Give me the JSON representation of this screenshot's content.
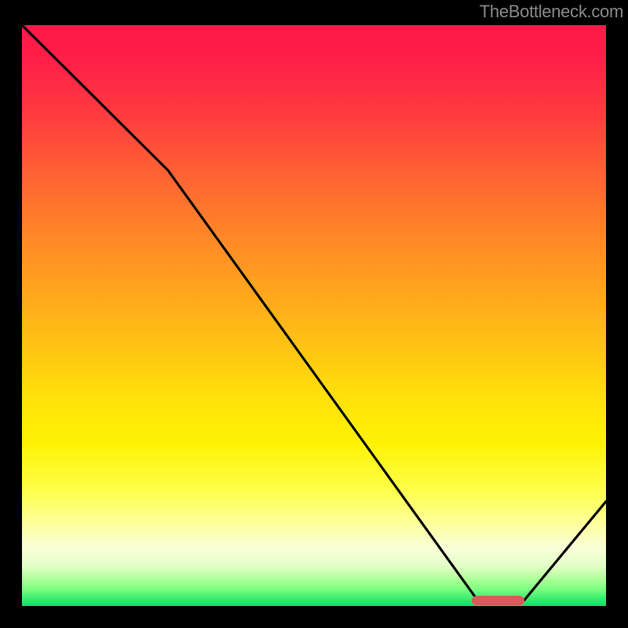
{
  "watermark": "TheBottleneck.com",
  "chart_data": {
    "type": "line",
    "title": "",
    "xlabel": "",
    "ylabel": "",
    "xlim": [
      0,
      100
    ],
    "ylim": [
      0,
      100
    ],
    "series": [
      {
        "name": "curve",
        "x": [
          0,
          25,
          78,
          86,
          100
        ],
        "values": [
          100,
          75,
          1,
          1,
          18
        ]
      }
    ],
    "marker": {
      "x_start": 77,
      "x_end": 86,
      "y": 1
    },
    "background_gradient": {
      "direction": "vertical",
      "stops": [
        {
          "pos": 0.0,
          "color": "#ff1948"
        },
        {
          "pos": 0.36,
          "color": "#ff8628"
        },
        {
          "pos": 0.64,
          "color": "#ffe10a"
        },
        {
          "pos": 0.86,
          "color": "#fdffa0"
        },
        {
          "pos": 0.97,
          "color": "#7fff81"
        },
        {
          "pos": 1.0,
          "color": "#1cd868"
        }
      ]
    }
  }
}
